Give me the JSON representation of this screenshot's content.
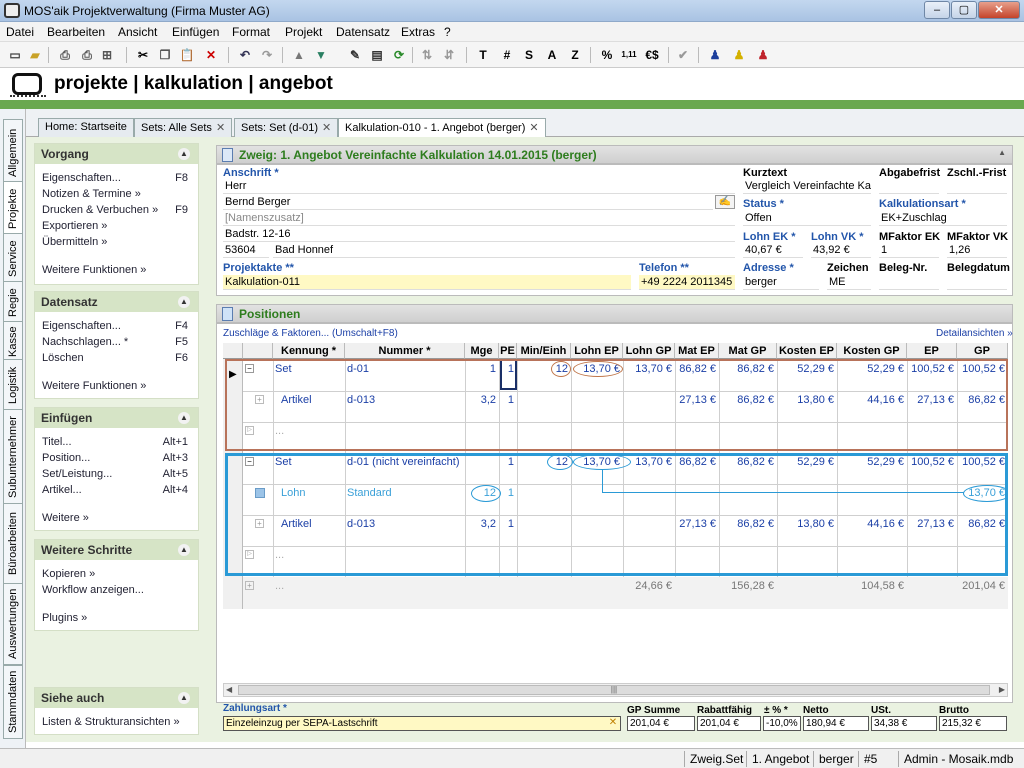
{
  "window": {
    "title": "MOS'aik Projektverwaltung (Firma Muster AG)",
    "min": "–",
    "max": "▢",
    "close": "✕"
  },
  "menu": [
    "Datei",
    "Bearbeiten",
    "Ansicht",
    "Einfügen",
    "Format",
    "Projekt",
    "Datensatz",
    "Extras",
    "?"
  ],
  "toolbar_text": {
    "t": "T",
    "hash": "#",
    "s": "S",
    "a": "A",
    "z": "Z",
    "pct": "%",
    "frac": "1,11",
    "eur": "€$"
  },
  "header": {
    "title": "projekte | kalkulation | angebot"
  },
  "vtabs": [
    "Allgemein",
    "Projekte",
    "Service",
    "Regie",
    "Kasse",
    "Logistik",
    "Subunternehmer",
    "Büroarbeiten",
    "Auswertungen",
    "Stammdaten"
  ],
  "doctabs": [
    "Home: Startseite",
    "Sets: Alle Sets",
    "Sets: Set (d-01)",
    "Kalkulation-010 - 1. Angebot (berger)"
  ],
  "sidebar": {
    "vorgang": {
      "title": "Vorgang",
      "items": [
        {
          "label": "Eigenschaften...",
          "key": "F8"
        },
        {
          "label": "Notizen & Termine »",
          "key": ""
        },
        {
          "label": "Drucken & Verbuchen »",
          "key": "F9"
        },
        {
          "label": "Exportieren »",
          "key": ""
        },
        {
          "label": "Übermitteln »",
          "key": ""
        }
      ],
      "more": "Weitere Funktionen »"
    },
    "datensatz": {
      "title": "Datensatz",
      "items": [
        {
          "label": "Eigenschaften...",
          "key": "F4"
        },
        {
          "label": "Nachschlagen... *",
          "key": "F5"
        },
        {
          "label": "Löschen",
          "key": "F6"
        }
      ],
      "more": "Weitere Funktionen »"
    },
    "einfuegen": {
      "title": "Einfügen",
      "items": [
        {
          "label": "Titel...",
          "key": "Alt+1"
        },
        {
          "label": "Position...",
          "key": "Alt+3"
        },
        {
          "label": "Set/Leistung...",
          "key": "Alt+5"
        },
        {
          "label": "Artikel...",
          "key": "Alt+4"
        }
      ],
      "more": "Weitere »"
    },
    "schritte": {
      "title": "Weitere Schritte",
      "items": [
        {
          "label": "Kopieren »"
        },
        {
          "label": "Workflow anzeigen..."
        }
      ],
      "more": "Plugins »"
    },
    "siehe": {
      "title": "Siehe auch",
      "items": [
        {
          "label": "Listen & Strukturansichten »"
        }
      ]
    }
  },
  "zweig": {
    "title": "Zweig: 1. Angebot Vereinfachte Kalkulation 14.01.2015 (berger)",
    "anschrift_label": "Anschrift *",
    "anrede": "Herr",
    "name": "Bernd Berger",
    "namenszusatz": "[Namenszusatz]",
    "strasse": "Badstr. 12-16",
    "plz": "53604",
    "ort": "Bad Honnef",
    "projektakte_label": "Projektakte **",
    "projektakte": "Kalkulation-011",
    "telefon_label": "Telefon **",
    "telefon": "+49 2224 2011345",
    "kurztext_label": "Kurztext",
    "kurztext": "Vergleich Vereinfachte Kalk",
    "abgabefrist_label": "Abgabefrist",
    "zschl_label": "Zschl.-Frist",
    "status_label": "Status *",
    "status": "Offen",
    "kalkart_label": "Kalkulationsart *",
    "kalkart": "EK+Zuschlag",
    "lohnek_label": "Lohn EK *",
    "lohnek": "40,67 €",
    "lohnvk_label": "Lohn VK *",
    "lohnvk": "43,92 €",
    "mfek_label": "MFaktor EK",
    "mfek": "1",
    "mfvk_label": "MFaktor VK",
    "mfvk": "1,26",
    "adresse_label": "Adresse *",
    "adresse": "berger",
    "zeichen_label": "Zeichen",
    "zeichen": "ME",
    "belegnr_label": "Beleg-Nr.",
    "belegdatum_label": "Belegdatum"
  },
  "positionen": {
    "title": "Positionen",
    "zuschlaege": "Zuschläge & Faktoren... (Umschalt+F8)",
    "details": "Detailansichten »",
    "columns": [
      "Kennung *",
      "Nummer *",
      "Mge",
      "PE",
      "Min/Einh",
      "Lohn EP",
      "Lohn GP",
      "Mat EP",
      "Mat GP",
      "Kosten EP",
      "Kosten GP",
      "EP",
      "GP"
    ],
    "rows": [
      {
        "kennung": "Set",
        "nummer": "d-01",
        "mge": "1",
        "pe": "1",
        "min": "12",
        "lohnep": "13,70 €",
        "lohngp": "13,70 €",
        "matep": "86,82 €",
        "matgp": "86,82 €",
        "kostenep": "52,29 €",
        "kostengp": "52,29 €",
        "ep": "100,52 €",
        "gp": "100,52 €"
      },
      {
        "kennung": "Artikel",
        "nummer": "d-013",
        "mge": "3,2",
        "pe": "1",
        "min": "",
        "lohnep": "",
        "lohngp": "",
        "matep": "27,13 €",
        "matgp": "86,82 €",
        "kostenep": "13,80 €",
        "kostengp": "44,16 €",
        "ep": "27,13 €",
        "gp": "86,82 €"
      },
      {
        "kennung": "...",
        "nummer": "",
        "mge": "",
        "pe": "",
        "min": "",
        "lohnep": "",
        "lohngp": "",
        "matep": "",
        "matgp": "",
        "kostenep": "",
        "kostengp": "",
        "ep": "",
        "gp": ""
      },
      {
        "kennung": "Set",
        "nummer": "d-01 (nicht vereinfacht)",
        "mge": "",
        "pe": "1",
        "min": "12",
        "lohnep": "13,70 €",
        "lohngp": "13,70 €",
        "matep": "86,82 €",
        "matgp": "86,82 €",
        "kostenep": "52,29 €",
        "kostengp": "52,29 €",
        "ep": "100,52 €",
        "gp": "100,52 €"
      },
      {
        "kennung": "Lohn",
        "nummer": "Standard",
        "mge": "12",
        "pe": "1",
        "min": "",
        "lohnep": "",
        "lohngp": "",
        "matep": "",
        "matgp": "",
        "kostenep": "",
        "kostengp": "",
        "ep": "",
        "gp": "13,70 €"
      },
      {
        "kennung": "Artikel",
        "nummer": "d-013",
        "mge": "3,2",
        "pe": "1",
        "min": "",
        "lohnep": "",
        "lohngp": "",
        "matep": "27,13 €",
        "matgp": "86,82 €",
        "kostenep": "13,80 €",
        "kostengp": "44,16 €",
        "ep": "27,13 €",
        "gp": "86,82 €"
      },
      {
        "kennung": "...",
        "nummer": "",
        "mge": "",
        "pe": "",
        "min": "",
        "lohnep": "",
        "lohngp": "",
        "matep": "",
        "matgp": "",
        "kostenep": "",
        "kostengp": "",
        "ep": "",
        "gp": ""
      },
      {
        "kennung": "...",
        "nummer": "",
        "mge": "",
        "pe": "",
        "min": "",
        "lohnep": "",
        "lohngp": "24,66 €",
        "matep": "",
        "matgp": "156,28 €",
        "kostenep": "",
        "kostengp": "104,58 €",
        "ep": "",
        "gp": "201,04 €"
      }
    ],
    "scroll_grip": "|||"
  },
  "footer": {
    "zahlungsart_label": "Zahlungsart *",
    "zahlungsart": "Einzeleinzug per SEPA-Lastschrift",
    "gpsumme_label": "GP Summe",
    "gpsumme": "201,04 €",
    "rabatt_label": "Rabattfähig",
    "rabatt": "201,04 €",
    "pct_label": "± % *",
    "pct": "-10,0%",
    "netto_label": "Netto",
    "netto": "180,94 €",
    "ust_label": "USt.",
    "ust": "34,38 €",
    "brutto_label": "Brutto",
    "brutto": "215,32 €"
  },
  "statusbar": [
    "Zweig.Set",
    "1. Angebot",
    "berger",
    "#5",
    "Admin - Mosaik.mdb"
  ]
}
